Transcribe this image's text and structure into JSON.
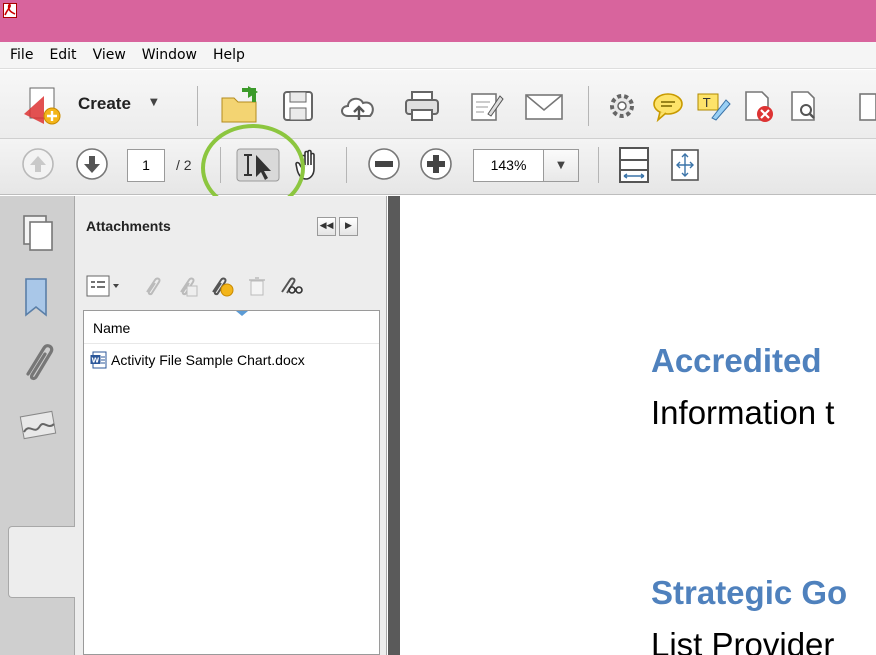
{
  "menu": [
    "File",
    "Edit",
    "View",
    "Window",
    "Help"
  ],
  "toolbar": {
    "create_label": "Create",
    "caret": "▼",
    "page_current": "1",
    "page_total": "/ 2",
    "zoom": "143%",
    "zoom_caret": "▼"
  },
  "panel": {
    "title": "Attachments",
    "collapse_glyph": "◀◀",
    "expand_glyph": "▶",
    "column_name": "Name",
    "files": [
      {
        "name": "Activity File Sample Chart.docx",
        "icon": "word-doc-icon"
      }
    ]
  },
  "document": {
    "heading1": "Accredited",
    "line1": "Information t",
    "heading2": "Strategic Go",
    "line2": "List Provider"
  },
  "colors": {
    "titlebar": "#d8649d",
    "highlight_ring": "#8cc63f",
    "heading": "#4f81bd"
  }
}
